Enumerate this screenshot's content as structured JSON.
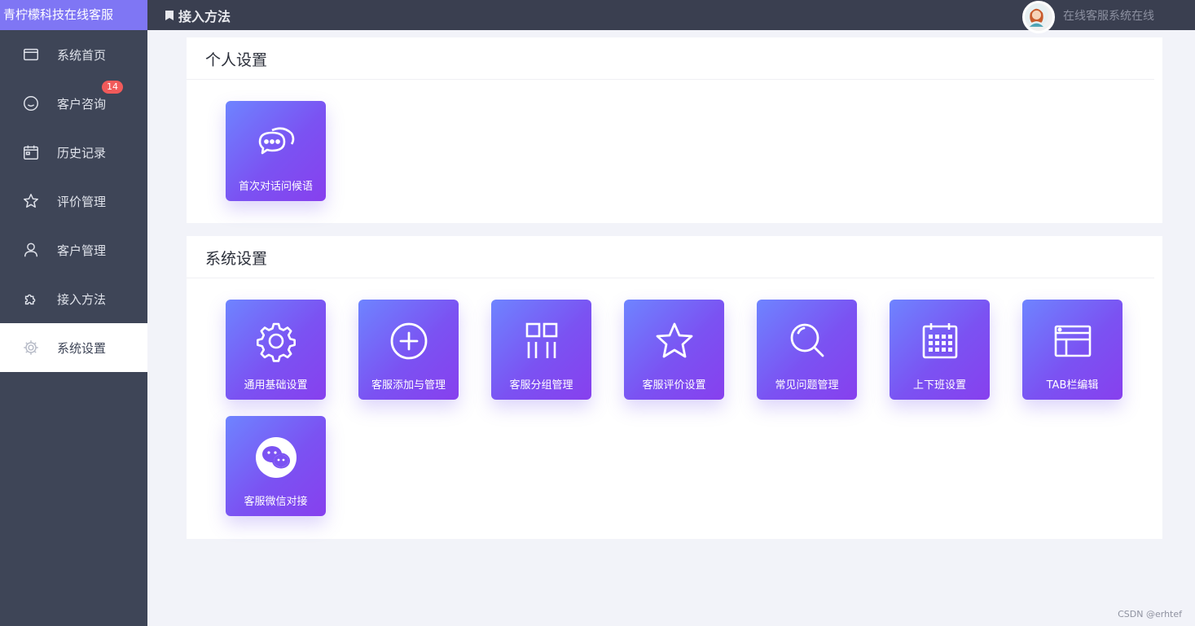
{
  "app": {
    "brand": "青柠檬科技在线客服"
  },
  "sidebar": {
    "items": [
      {
        "label": "系统首页",
        "icon": "window-icon"
      },
      {
        "label": "客户咨询",
        "icon": "chat-bubble-icon",
        "badge": "14"
      },
      {
        "label": "历史记录",
        "icon": "calendar-icon"
      },
      {
        "label": "评价管理",
        "icon": "star-icon"
      },
      {
        "label": "客户管理",
        "icon": "user-icon"
      },
      {
        "label": "接入方法",
        "icon": "puzzle-icon"
      },
      {
        "label": "系统设置",
        "icon": "gear-icon",
        "active": true
      }
    ]
  },
  "header": {
    "breadcrumb": "接入方法",
    "status_text": "在线客服系统在线"
  },
  "sections": {
    "personal": {
      "title": "个人设置",
      "tiles": [
        {
          "label": "首次对话问候语",
          "icon": "chat-bubbles-icon"
        }
      ]
    },
    "system": {
      "title": "系统设置",
      "tiles": [
        {
          "label": "通用基础设置",
          "icon": "gear-icon"
        },
        {
          "label": "客服添加与管理",
          "icon": "plus-circle-icon"
        },
        {
          "label": "客服分组管理",
          "icon": "group-icon"
        },
        {
          "label": "客服评价设置",
          "icon": "star-icon"
        },
        {
          "label": "常见问题管理",
          "icon": "search-icon"
        },
        {
          "label": "上下班设置",
          "icon": "calendar-icon"
        },
        {
          "label": "TAB栏编辑",
          "icon": "window-icon"
        },
        {
          "label": "客服微信对接",
          "icon": "wechat-icon"
        }
      ]
    }
  },
  "footer": {
    "watermark": "CSDN @erhtef"
  },
  "colors": {
    "sidebar_bg": "#3e4557",
    "brand_bg": "#7f76f4",
    "header_bg": "#3a3f50",
    "tile_gradient_start": "#6e84ff",
    "tile_gradient_end": "#8740ee",
    "badge": "#f15a5a"
  }
}
